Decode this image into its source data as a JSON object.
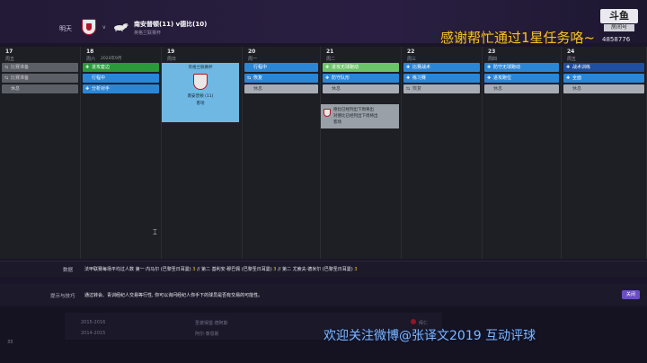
{
  "header": {
    "tomorrow": "明天",
    "vs": "v",
    "match_title": "南安普顿(11) v德比(10)",
    "match_sub": "英格兰联赛杯"
  },
  "stream": {
    "thanks": "感谢帮忙通过1星任务咯~",
    "brand": "斗鱼",
    "room_label": "房间号",
    "room_number": "4858776",
    "weibo": "欢迎关注微博@张译文2019 互动评球"
  },
  "calendar": {
    "days": [
      {
        "num": "17",
        "wk": "周五",
        "month": "",
        "slots": [
          {
            "icon": "⇆",
            "label": "比赛准备",
            "color": "dgrey"
          },
          {
            "icon": "⇆",
            "label": "比赛准备",
            "color": "dgrey"
          },
          {
            "icon": "",
            "label": "休息",
            "color": "dgrey"
          }
        ]
      },
      {
        "num": "18",
        "wk": "周六",
        "month": "2024年9月",
        "slots": [
          {
            "icon": "✚",
            "label": "进攻套边",
            "color": "green"
          },
          {
            "icon": "",
            "label": "行程中",
            "color": "blue"
          },
          {
            "icon": "✚",
            "label": "分析对手",
            "color": "blue"
          }
        ]
      },
      {
        "num": "19",
        "wk": "周日",
        "month": "",
        "slots": []
      },
      {
        "num": "20",
        "wk": "周一",
        "month": "",
        "slots": [
          {
            "icon": "",
            "label": "行程中",
            "color": "blue"
          },
          {
            "icon": "⇆",
            "label": "恢复",
            "color": "blue"
          },
          {
            "icon": "",
            "label": "休息",
            "color": "grey"
          }
        ]
      },
      {
        "num": "21",
        "wk": "周二",
        "month": "",
        "slots": [
          {
            "icon": "✚",
            "label": "进攻无球跑动",
            "color": "lgreen"
          },
          {
            "icon": "✚",
            "label": "防守队形",
            "color": "blue"
          },
          {
            "icon": "",
            "label": "休息",
            "color": "grey"
          }
        ]
      },
      {
        "num": "22",
        "wk": "周三",
        "month": "",
        "slots": [
          {
            "icon": "✚",
            "label": "比赛战术",
            "color": "blue"
          },
          {
            "icon": "✚",
            "label": "练习赛",
            "color": "blue"
          },
          {
            "icon": "⇆",
            "label": "恢复",
            "color": "grey"
          }
        ]
      },
      {
        "num": "23",
        "wk": "周四",
        "month": "",
        "slots": [
          {
            "icon": "✚",
            "label": "防守无球跑动",
            "color": "blue"
          },
          {
            "icon": "✚",
            "label": "进攻跑位",
            "color": "blue"
          },
          {
            "icon": "",
            "label": "休息",
            "color": "grey"
          }
        ]
      },
      {
        "num": "24",
        "wk": "周五",
        "month": "",
        "slots": [
          {
            "icon": "✚",
            "label": "战术训练",
            "color": "navy"
          },
          {
            "icon": "✚",
            "label": "全面",
            "color": "blue"
          },
          {
            "icon": "",
            "label": "休息",
            "color": "grey"
          }
        ]
      }
    ],
    "match_card": {
      "title": "英格兰联赛杯",
      "text": "南安普顿 (11)",
      "sub": "客场"
    },
    "note": {
      "line1": "德比已经列出下周将出",
      "line2": "对德比已经列出下周将出",
      "line3": "客场"
    }
  },
  "data_row": {
    "label": "数据",
    "prefix": "法甲联赛每场平均过人数 第一 内马尔 (巴黎圣日耳曼)",
    "v1": "3",
    "mid1": "// 第二 基利安·穆巴佩 (巴黎圣日耳曼)",
    "v2": "3",
    "mid2": "// 第二 尤索夫·德米尔 (巴黎圣日耳曼)",
    "v3": "3"
  },
  "tips": {
    "label": "提示与技巧",
    "text": "通过转会、青训经纪人交易等行性, 你可以询问经纪人你手下的球员是否有交易的可能性。",
    "button": "关闭"
  },
  "history": {
    "rows": [
      {
        "season": "2015-2016",
        "club": "圣彼得堡·德阿斯"
      },
      {
        "season": "2014-2015",
        "club": "阿尔·泰恩斯"
      }
    ],
    "badge": "拜仁"
  },
  "corner": "33"
}
